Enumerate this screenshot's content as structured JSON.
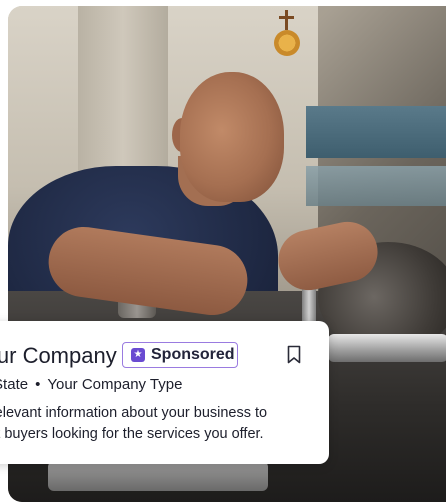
{
  "card": {
    "company_name": "Your Company",
    "badge": {
      "icon": "star-shield-icon",
      "label": "Sponsored",
      "border_color": "#9a7be0",
      "icon_color": "#6a4bd1"
    },
    "bookmark_icon": "bookmark-icon",
    "meta": {
      "location": "City, State",
      "separator": "•",
      "company_type": "Your Company Type"
    },
    "description_lines": [
      "Add relevant information about your business to",
      "attract buyers looking for the services you offer."
    ]
  },
  "photo": {
    "subject": "machinist-using-caliper",
    "tone_colors": [
      "#cfc9bd",
      "#1f2944",
      "#a56f51"
    ]
  }
}
